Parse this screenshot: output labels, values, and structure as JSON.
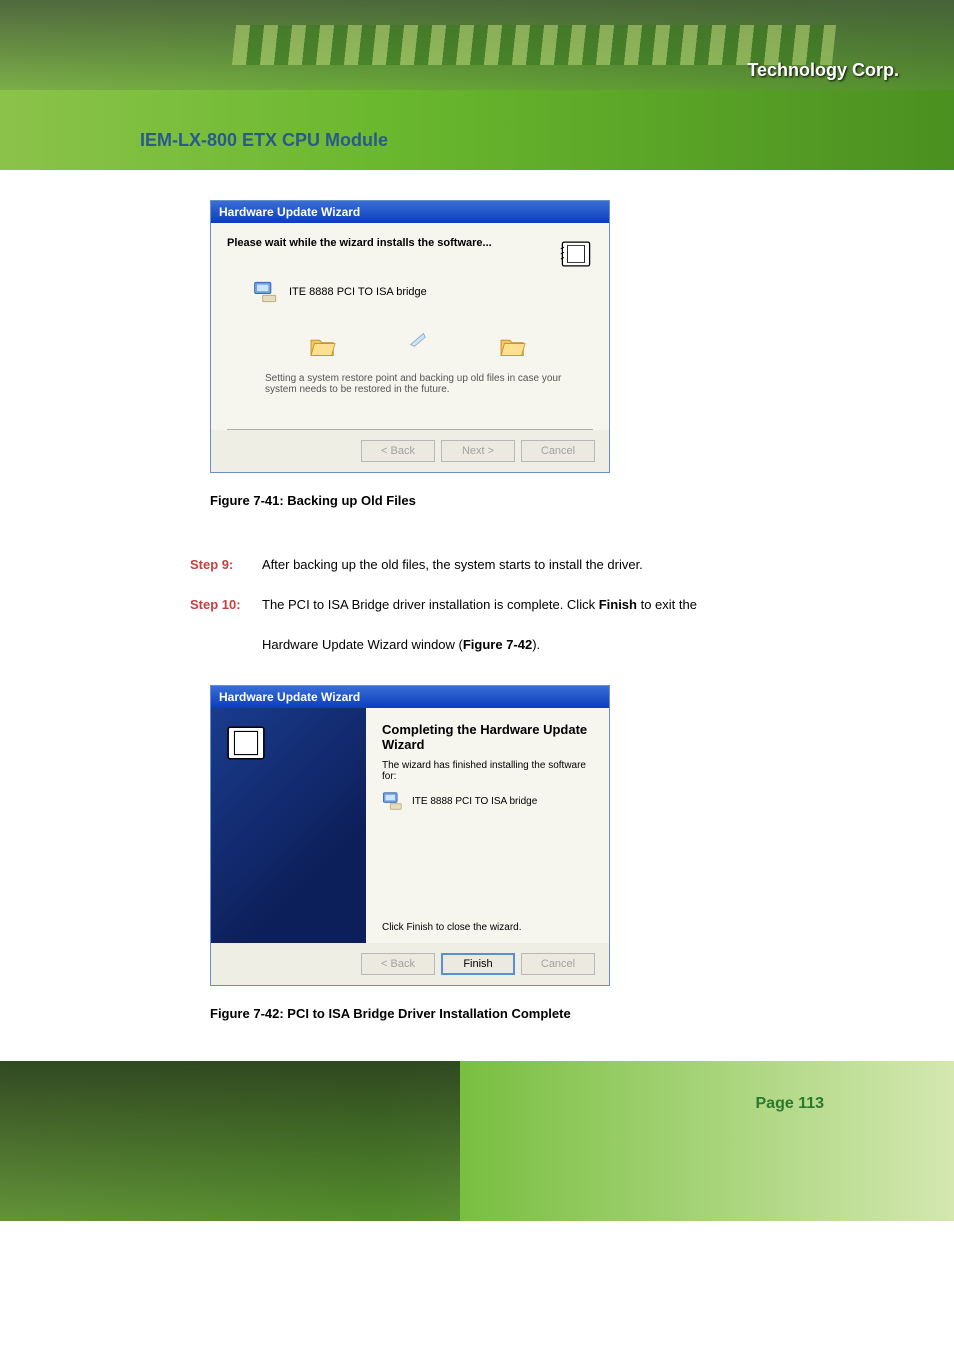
{
  "header": {
    "brand": "Technology Corp.",
    "module_title": "IEM-LX-800 ETX CPU Module"
  },
  "wizard1": {
    "title": "Hardware Update Wizard",
    "heading": "Please wait while the wizard installs the software...",
    "driver_name": "ITE 8888 PCI TO ISA bridge",
    "restore_text": "Setting a system restore point and backing up old files in case your system needs to be restored in the future.",
    "btn_back": "< Back",
    "btn_next": "Next >",
    "btn_cancel": "Cancel"
  },
  "figure1_caption": "Figure 7-41: Backing up Old Files",
  "steps": {
    "s9_label": "Step 9:",
    "s9_text": "After backing up the old files, the system starts to install the driver.",
    "s10_label": "Step 10:",
    "s10_text_1": "The PCI to ISA Bridge driver installation is complete. Click ",
    "s10_finish": "Finish",
    "s10_text_2": " to exit the",
    "s10_cont_1": "Hardware Update Wizard window (",
    "s10_fig_ref": "Figure 7-42",
    "s10_cont_2": ")."
  },
  "wizard2": {
    "title": "Hardware Update Wizard",
    "main_title": "Completing the Hardware Update Wizard",
    "subtitle": "The wizard has finished installing the software for:",
    "driver_name": "ITE 8888 PCI TO ISA bridge",
    "close_text": "Click Finish to close the wizard.",
    "btn_back": "< Back",
    "btn_finish": "Finish",
    "btn_cancel": "Cancel"
  },
  "figure2_caption": "Figure 7-42: PCI to ISA Bridge Driver Installation Complete",
  "footer": {
    "page_num": "Page 113"
  }
}
